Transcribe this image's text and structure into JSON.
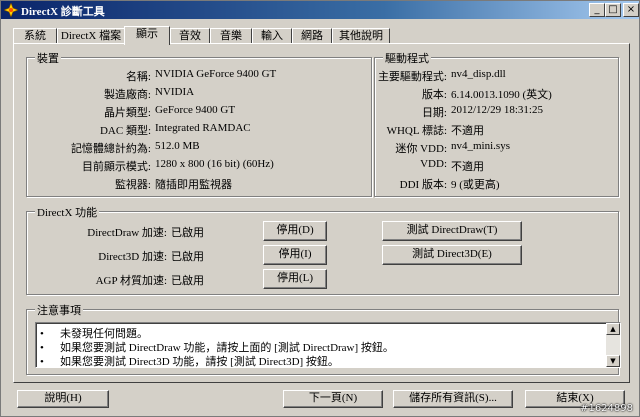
{
  "window": {
    "title": "DirectX 診斷工具",
    "minimize": "_",
    "maximize": "□",
    "close": "×"
  },
  "tabs": [
    "系統",
    "DirectX 檔案",
    "顯示",
    "音效",
    "音樂",
    "輸入",
    "網路",
    "其他說明"
  ],
  "active_tab": "顯示",
  "device": {
    "label": "裝置",
    "fields": [
      {
        "label": "名稱:",
        "value": "NVIDIA GeForce 9400 GT"
      },
      {
        "label": "製造廠商:",
        "value": "NVIDIA"
      },
      {
        "label": "晶片類型:",
        "value": "GeForce 9400 GT"
      },
      {
        "label": "DAC 類型:",
        "value": "Integrated RAMDAC"
      },
      {
        "label": "記憶體總計約為:",
        "value": "512.0 MB"
      },
      {
        "label": "目前顯示模式:",
        "value": "1280 x 800 (16 bit) (60Hz)"
      },
      {
        "label": "監視器:",
        "value": "隨插即用監視器"
      }
    ]
  },
  "driver": {
    "label": "驅動程式",
    "fields": [
      {
        "label": "主要驅動程式:",
        "value": "nv4_disp.dll"
      },
      {
        "label": "版本:",
        "value": "6.14.0013.1090 (英文)"
      },
      {
        "label": "日期:",
        "value": "2012/12/29 18:31:25"
      },
      {
        "label": "WHQL 標誌:",
        "value": "不適用"
      },
      {
        "label": "迷你 VDD:",
        "value": "nv4_mini.sys"
      },
      {
        "label": "VDD:",
        "value": "不適用"
      },
      {
        "label": "DDI 版本:",
        "value": "9 (或更高)"
      }
    ]
  },
  "directx": {
    "label": "DirectX 功能",
    "features": [
      {
        "label": "DirectDraw 加速:",
        "status": "已啟用",
        "disable_button": "停用(D)",
        "test_button": "測試 DirectDraw(T)"
      },
      {
        "label": "Direct3D 加速:",
        "status": "已啟用",
        "disable_button": "停用(I)",
        "test_button": "測試 Direct3D(E)"
      },
      {
        "label": "AGP 材質加速:",
        "status": "已啟用",
        "disable_button": "停用(L)",
        "test_button": ""
      }
    ]
  },
  "notes": {
    "label": "注意事項",
    "bullet": "•",
    "items": [
      "未發現任何問題。",
      "如果您要測試 DirectDraw 功能，請按上面的 [測試 DirectDraw] 按鈕。",
      "如果您要測試 Direct3D 功能，請按 [測試 Direct3D] 按鈕。"
    ]
  },
  "footer": {
    "help": "說明(H)",
    "next": "下一頁(N)",
    "save": "儲存所有資訊(S)...",
    "exit": "結束(X)"
  },
  "watermark": "#1624898"
}
